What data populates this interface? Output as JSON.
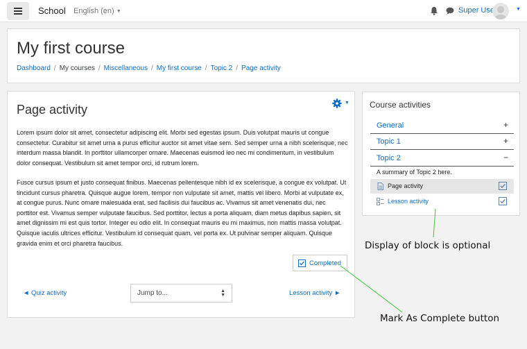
{
  "navbar": {
    "site_name": "School",
    "language": "English (en)",
    "username": "Super User",
    "icons": [
      "hamburger-icon",
      "bell-icon",
      "chat-icon",
      "user-avatar",
      "caret-down-icon"
    ]
  },
  "header": {
    "course_title": "My first course",
    "breadcrumb": {
      "dashboard": "Dashboard",
      "my_courses": "My courses",
      "category": "Miscellaneous",
      "course": "My first course",
      "topic": "Topic 2",
      "activity": "Page activity",
      "separator": "/"
    }
  },
  "page": {
    "heading": "Page activity",
    "paragraph_1": "Lorem ipsum dolor sit amet, consectetur adipiscing elit. Morbi sed egestas ipsum. Duis volutpat mauris ut congue consectetur. Curabitur sit amet urna a purus efficitur auctor sit amet vitae sem. Sed semper urna a nibh scelerisque, nec interdum massa blandit. In porttitor ullamcorper ornare. Maecenas euismod leo nec mi condimentum, in vestibulum dolor consequat. Vestibulum sit amet tempor orci, id rutrum lorem.",
    "paragraph_2": "Fusce cursus ipsum et justo consequat finibus. Maecenas pellentesque nibh id ex scelerisque, a congue ex volutpat. Ut tincidunt cursus pharetra. Quisque augue lorem, tempor non vulputate sit amet, mattis vel libero. Morbi at vulputate ex, at congue purus. Nunc ornare malesuada erat, sed facilisis dui faucibus ac. Vivamus sit amet venenatis dui, nec porttitor est. Vivamus semper vulputate faucibus. Sed porttitor, lectus a porta aliquam, diam metus dapibus sapien, sit amet dignissim mi est quis tortor. Integer eu odio elit. In consequat mauris eu mi maximus, non mattis massa volutpat. Quisque iaculis ultrices efficitur. Vestibulum id consequat quam, vel porta ex. Ut pulvinar semper aliquam. Quisque gravida enim et orci pharetra faucibus.",
    "completed_label": "Completed",
    "prev_link": "◄ Quiz activity",
    "next_link": "Lesson activity ►",
    "jump_to": "Jump to..."
  },
  "block": {
    "title": "Course activities",
    "sections": [
      {
        "name": "General",
        "toggle": "+"
      },
      {
        "name": "Topic 1",
        "toggle": "+"
      },
      {
        "name": "Topic 2",
        "toggle": "−"
      }
    ],
    "summary": "A summary of Topic 2 here.",
    "activities": [
      {
        "label": "Page activity",
        "completed": true,
        "icon": "page-icon"
      },
      {
        "label": "Lesson activity",
        "completed": true,
        "icon": "lesson-icon"
      }
    ]
  },
  "annotations": {
    "block_note": "Display of block is optional",
    "button_note": "Mark As Complete button"
  },
  "colors": {
    "link": "#0f6cbf",
    "annotation_line": "#37c837",
    "background": "#f2f2f2"
  }
}
